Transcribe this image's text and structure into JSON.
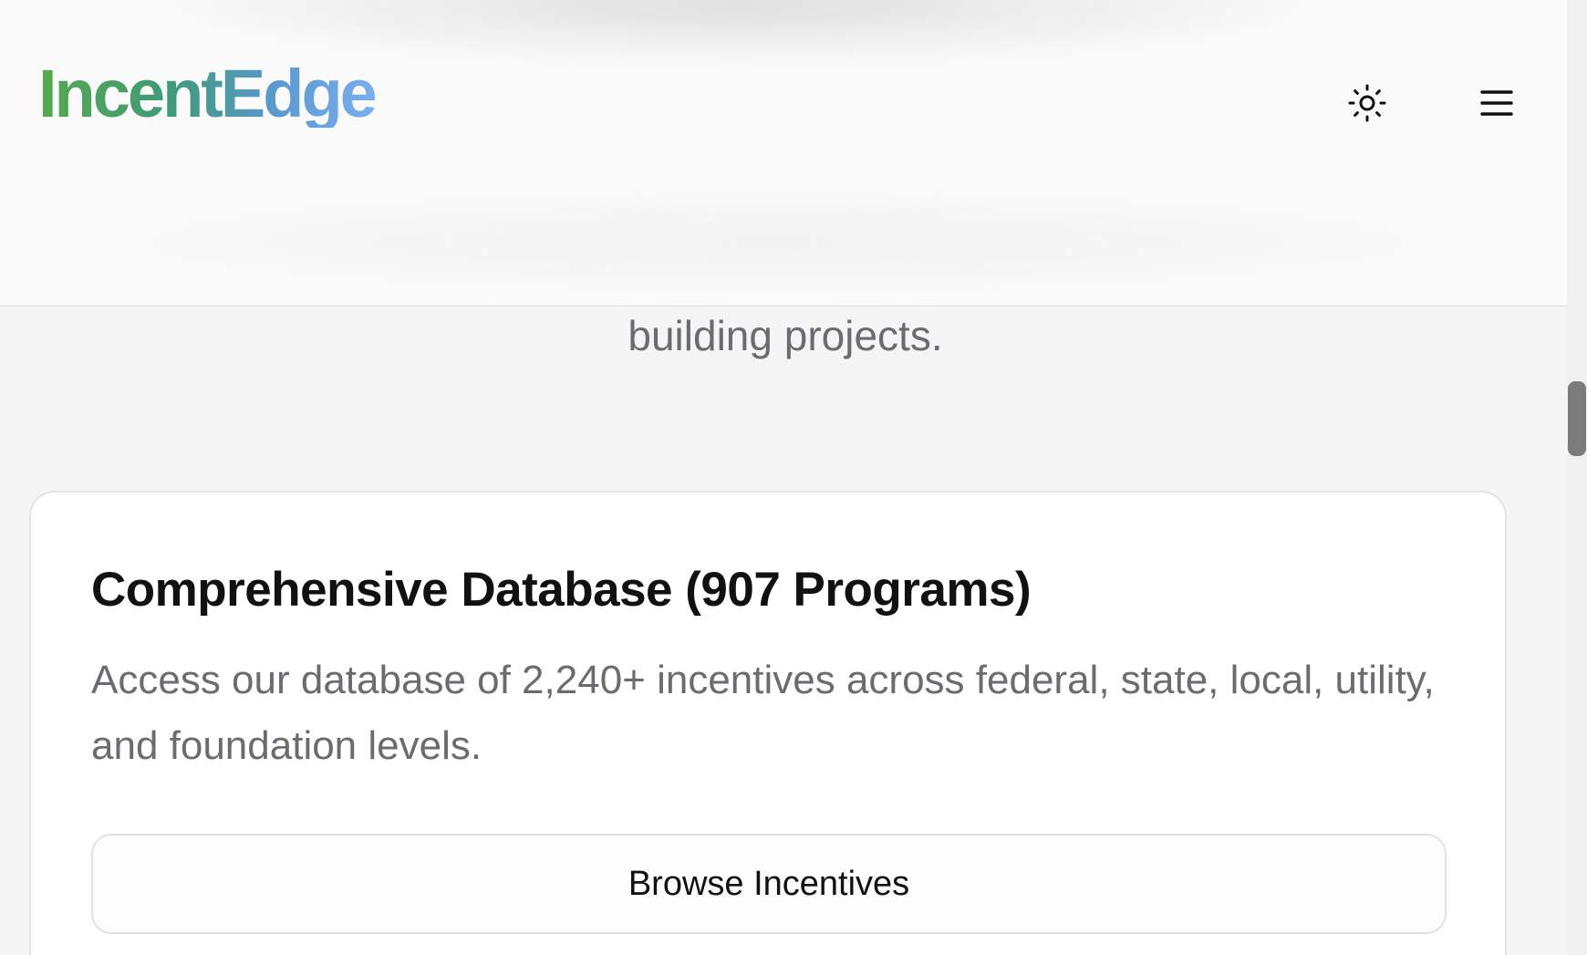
{
  "header": {
    "logo_text": "IncentEdge",
    "theme_toggle_icon": "sun-icon",
    "menu_icon": "hamburger-menu-icon"
  },
  "intro": {
    "tail_text": "building projects."
  },
  "card": {
    "title": "Comprehensive Database (907 Programs)",
    "description": "Access our database of 2,240+ incentives across federal, state, local, utility, and foundation levels.",
    "button_label": "Browse Incentives"
  },
  "colors": {
    "logo_gradient_start": "#57a84e",
    "logo_gradient_end": "#7aaef0",
    "text_primary": "#111114",
    "text_secondary": "#6b6b72"
  }
}
